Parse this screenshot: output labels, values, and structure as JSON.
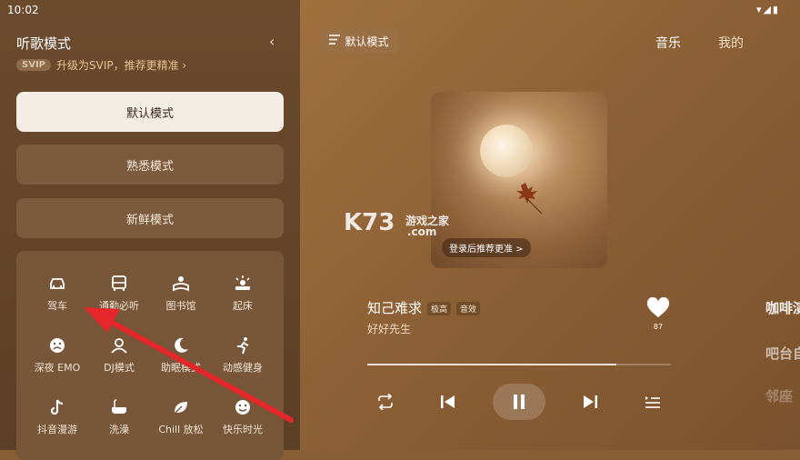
{
  "status_bar": {
    "time": "10:02",
    "icons": "▾◢▮"
  },
  "panel": {
    "title": "听歌模式",
    "collapse_icon": "‹",
    "svip_badge": "SVIP",
    "svip_text": "升级为SVIP，推荐更精准 ›"
  },
  "modes": [
    {
      "label": "默认模式",
      "active": true
    },
    {
      "label": "熟悉模式",
      "active": false
    },
    {
      "label": "新鲜模式",
      "active": false
    }
  ],
  "scenes": [
    {
      "label": "驾车",
      "icon": "car-icon"
    },
    {
      "label": "通勤必听",
      "icon": "bus-icon"
    },
    {
      "label": "图书馆",
      "icon": "reading-icon"
    },
    {
      "label": "起床",
      "icon": "sunrise-icon"
    },
    {
      "label": "深夜 EMO",
      "icon": "sad-face-icon"
    },
    {
      "label": "DJ模式",
      "icon": "dj-icon"
    },
    {
      "label": "助眠模式",
      "icon": "moon-icon"
    },
    {
      "label": "动感健身",
      "icon": "running-icon"
    },
    {
      "label": "抖音漫游",
      "icon": "tiktok-icon"
    },
    {
      "label": "洗澡",
      "icon": "bathtub-icon"
    },
    {
      "label": "Chill 放松",
      "icon": "leaf-icon"
    },
    {
      "label": "快乐时光",
      "icon": "smile-icon"
    }
  ],
  "header": {
    "mode_button": "默认模式",
    "tabs": [
      "音乐",
      "我的"
    ]
  },
  "cover": {
    "login_tip": "登录后推荐更准 >"
  },
  "watermark": {
    "logo": "K73",
    "text": "游戏之家",
    "domain": ".com"
  },
  "song": {
    "title": "知己难求",
    "tags": [
      "极高",
      "音效"
    ],
    "artist": "好好先生",
    "likes": "87"
  },
  "player": {
    "progress_percent": 82
  },
  "lyrics": [
    "咖啡演",
    "吧台自",
    "邻座"
  ],
  "colors": {
    "accent": "#e7c391",
    "active_mode_bg": "#f4ede6",
    "arrow": "#e5262a"
  }
}
